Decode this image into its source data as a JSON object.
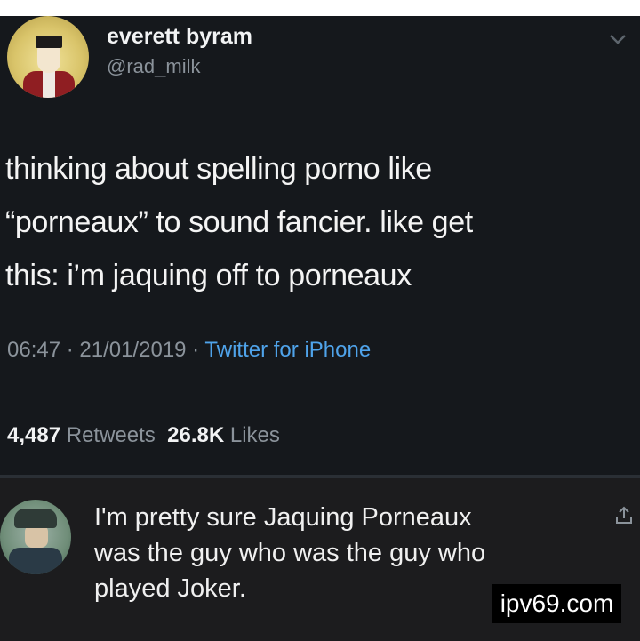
{
  "tweet": {
    "display_name": "everett byram",
    "handle": "@rad_milk",
    "lines": [
      "thinking about spelling porno like",
      "“porneaux” to sound fancier. like get",
      "this: i’m jaquing off to porneaux"
    ],
    "time": "06:47",
    "date": "21/01/2019",
    "separator": " · ",
    "source": "Twitter for iPhone",
    "retweets_count": "4,487",
    "retweets_label": "Retweets",
    "likes_count": "26.8K",
    "likes_label": "Likes"
  },
  "reply": {
    "lines": [
      "I'm pretty sure Jaquing Porneaux",
      "was the guy who was the guy who",
      "played Joker."
    ]
  },
  "watermark": "ipv69.com",
  "colors": {
    "background": "#15181c",
    "reply_background": "#1c1c1e",
    "link": "#4fa3ea",
    "muted": "#8b939b"
  },
  "icons": {
    "menu": "chevron-down-icon",
    "reply_action": "share-icon"
  }
}
